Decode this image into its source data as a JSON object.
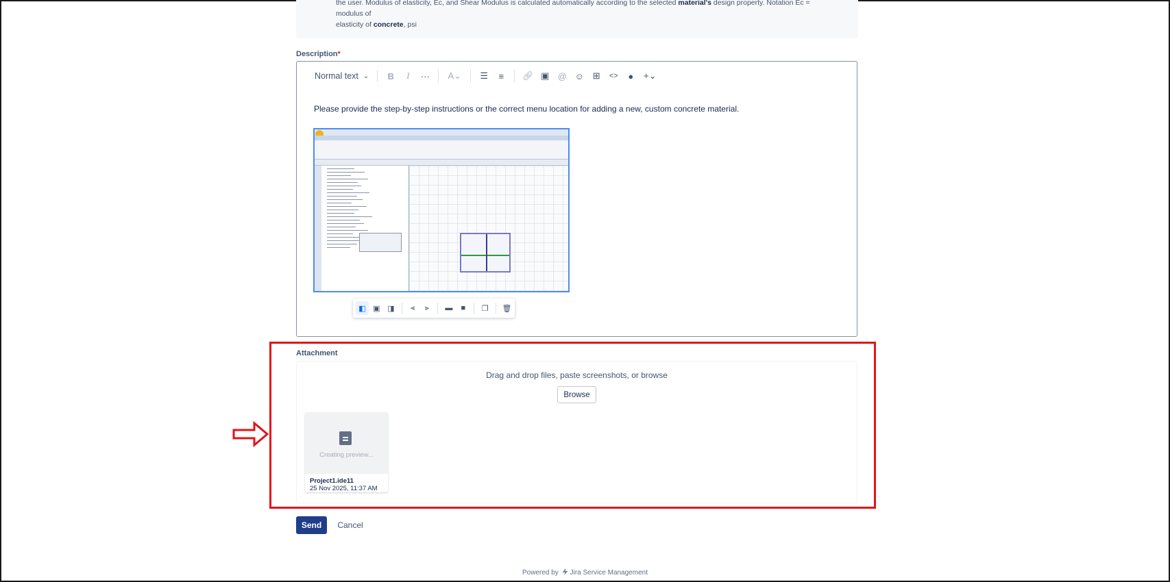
{
  "help": {
    "line1_a": "the user. Modulus of elasticity, Ec, and Shear Modulus is calculated automatically according to the selected ",
    "line1_b": "material's",
    "line1_c": " design property. Notation Ec = modulus of",
    "line2_a": "elasticity of ",
    "line2_b": "concrete",
    "line2_c": ", psi"
  },
  "description": {
    "label": "Description",
    "required_mark": "*",
    "text_style": "Normal text",
    "text_style_caret": "⌄",
    "body_text": "Please provide the step-by-step instructions or the correct menu location for adding a new, custom concrete material.",
    "toolbar_icons": [
      "bold-icon",
      "italic-icon",
      "more-formatting-icon",
      "text-color-icon",
      "bullet-list-icon",
      "numbered-list-icon",
      "link-icon",
      "image-icon",
      "mention-icon",
      "emoji-icon",
      "table-icon",
      "code-icon",
      "info-icon",
      "insert-more-icon"
    ],
    "image_toolbar_icons": [
      "align-left-icon",
      "align-center-icon",
      "align-right-icon",
      "wrap-left-icon",
      "wrap-right-icon",
      "width-wide-icon",
      "width-full-icon",
      "copy-icon",
      "delete-icon"
    ]
  },
  "attachment": {
    "label": "Attachment",
    "drop_text": "Drag and drop files, paste screenshots, or browse",
    "browse_label": "Browse",
    "file": {
      "status": "Creating preview...",
      "name": "Project1.ide11",
      "date": "25 Nov 2025, 11:37 AM"
    }
  },
  "actions": {
    "send_label": "Send",
    "cancel_label": "Cancel"
  },
  "footer": {
    "powered_prefix": "Powered by",
    "product": "Jira Service Management"
  },
  "colors": {
    "primary_button": "#1f3e8a",
    "highlight_frame": "#e2141b",
    "required": "#c9372c"
  }
}
